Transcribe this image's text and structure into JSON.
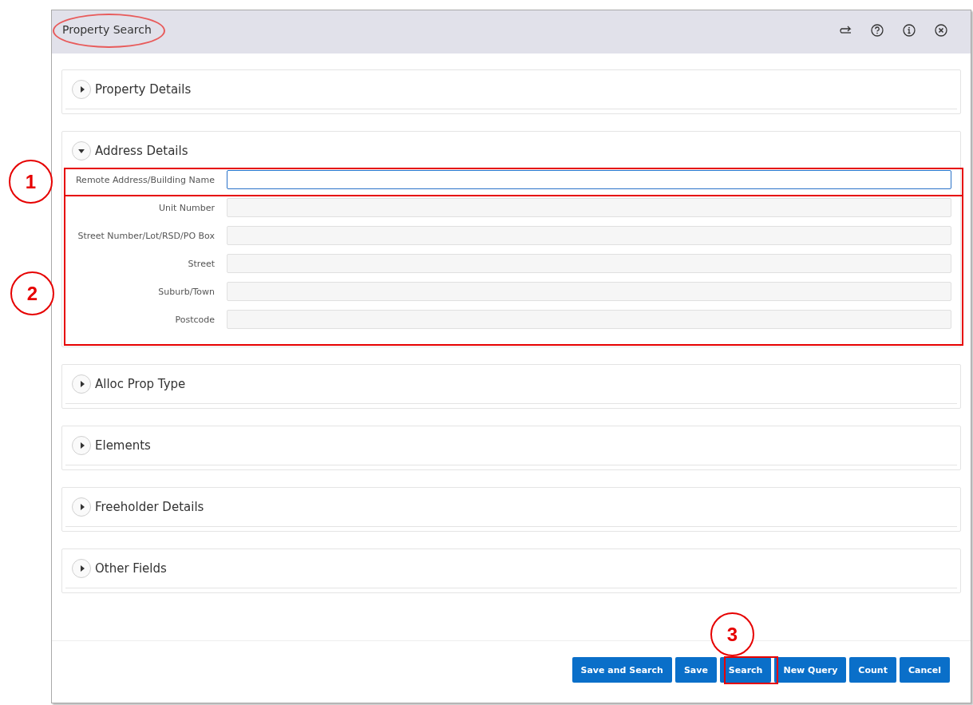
{
  "window": {
    "title": "Property Search"
  },
  "header_icons": [
    {
      "kind": "redo"
    },
    {
      "kind": "help"
    },
    {
      "kind": "info"
    },
    {
      "kind": "close"
    }
  ],
  "sections": [
    {
      "title": "Property Details",
      "expanded": false
    },
    {
      "title": "Address Details",
      "expanded": true,
      "fields": [
        {
          "label": "Remote Address/Building Name",
          "focused": true
        },
        {
          "label": "Unit Number",
          "focused": false
        },
        {
          "label": "Street Number/Lot/RSD/PO Box",
          "focused": false
        },
        {
          "label": "Street",
          "focused": false
        },
        {
          "label": "Suburb/Town",
          "focused": false
        },
        {
          "label": "Postcode",
          "focused": false
        }
      ]
    },
    {
      "title": "Alloc Prop Type",
      "expanded": false
    },
    {
      "title": "Elements",
      "expanded": false
    },
    {
      "title": "Freeholder Details",
      "expanded": false
    },
    {
      "title": "Other Fields",
      "expanded": false
    }
  ],
  "buttons": [
    "Save and Search",
    "Save",
    "Search",
    "New Query",
    "Count",
    "Cancel"
  ],
  "callouts": [
    {
      "label": "1"
    },
    {
      "label": "2"
    },
    {
      "label": "3"
    }
  ]
}
